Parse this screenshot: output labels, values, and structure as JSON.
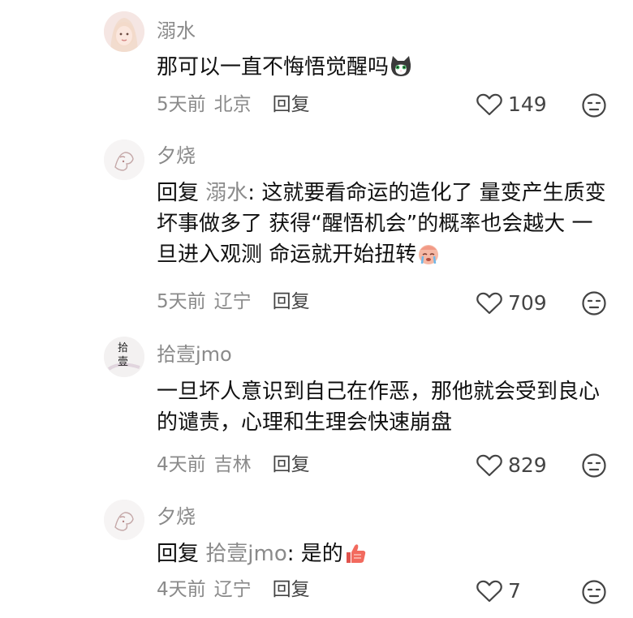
{
  "comments": [
    {
      "username": "溺水",
      "text": "那可以一直不悔悟觉醒吗",
      "emoji": "cat-emoji",
      "time": "5天前",
      "location": "北京",
      "reply_label": "回复",
      "likes": "149"
    },
    {
      "username": "夕烧",
      "reply_prefix": "回复",
      "reply_to": "溺水",
      "text": ": 这就要看命运的造化了 量变产生质变 坏事做多了 获得“醒悟机会”的概率也会越大 一旦进入观测 命运就开始扭转",
      "emoji": "crying-face-emoji",
      "time": "5天前",
      "location": "辽宁",
      "reply_label": "回复",
      "likes": "709"
    },
    {
      "username": "拾壹jmo",
      "avatar_text": "拾壹",
      "text": "一旦坏人意识到自己在作恶，那他就会受到良心的谴责，心理和生理会快速崩盘",
      "time": "4天前",
      "location": "吉林",
      "reply_label": "回复",
      "likes": "829"
    },
    {
      "username": "夕烧",
      "reply_prefix": "回复",
      "reply_to": "拾壹jmo",
      "text": ": 是的",
      "emoji": "thumbs-up-emoji",
      "time": "4天前",
      "location": "辽宁",
      "reply_label": "回复",
      "likes": "7"
    }
  ],
  "colors": {
    "text": "#111111",
    "meta": "#8a8a8a",
    "icon": "#444444"
  }
}
